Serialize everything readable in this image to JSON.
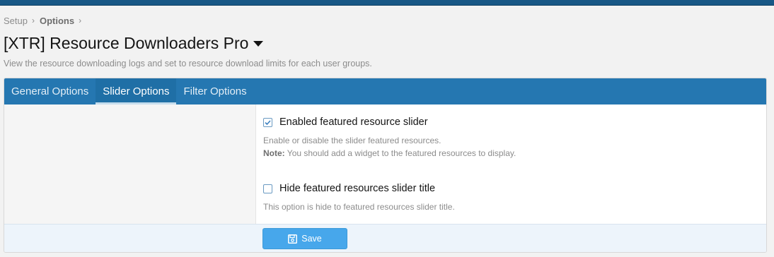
{
  "breadcrumb": {
    "items": [
      {
        "label": "Setup"
      },
      {
        "label": "Options"
      }
    ],
    "separator_icon": "chevron-right-icon"
  },
  "page": {
    "title": "[XTR] Resource Downloaders Pro",
    "title_menu_icon": "caret-down-icon",
    "description": "View the resource downloading logs and set to resource download limits for each user groups."
  },
  "tabs": [
    {
      "label": "General Options",
      "active": false
    },
    {
      "label": "Slider Options",
      "active": true
    },
    {
      "label": "Filter Options",
      "active": false
    }
  ],
  "options": {
    "enable_slider": {
      "label": "Enabled featured resource slider",
      "checked": true,
      "hint": "Enable or disable the slider featured resources.",
      "note_label": "Note:",
      "note_text": " You should add a widget to the featured resources to display."
    },
    "hide_title": {
      "label": "Hide featured resources slider title",
      "checked": false,
      "hint": "This option is hide to featured resources slider title."
    }
  },
  "footer": {
    "save_label": "Save",
    "save_icon": "floppy-disk-icon"
  },
  "colors": {
    "topbar": "#185886",
    "tab_bar": "#2577b1",
    "save_button": "#47a7eb",
    "footer_bg": "#edf4fb"
  }
}
